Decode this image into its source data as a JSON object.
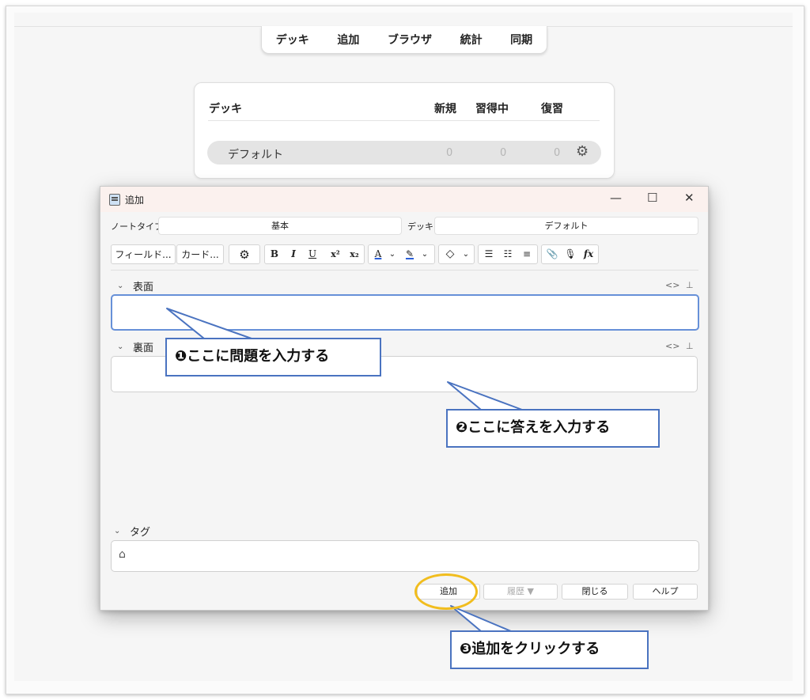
{
  "topnav": [
    "デッキ",
    "追加",
    "ブラウザ",
    "統計",
    "同期"
  ],
  "decklist": {
    "header": {
      "deck": "デッキ",
      "new": "新規",
      "learning": "習得中",
      "review": "復習"
    },
    "rows": [
      {
        "name": "デフォルト",
        "new": "0",
        "learning": "0",
        "review": "0"
      }
    ],
    "gear_icon": "gear-icon"
  },
  "window": {
    "title": "追加",
    "controls": {
      "minimize": "—",
      "maximize": "☐",
      "close": "✕"
    },
    "notetype_label": "ノートタイプ",
    "notetype_value": "基本",
    "deck_label": "デッキ",
    "deck_value": "デフォルト",
    "toolbar": {
      "fields_button": "フィールド...",
      "cards_button": "カード...",
      "gear": "⚙",
      "bold": "B",
      "italic": "I",
      "underline": "U",
      "sup": "x²",
      "sub": "x₂",
      "text_color": "A",
      "highlight": "✎",
      "dropdown": "⌄",
      "eraser": "◇",
      "ul": "☰",
      "ol": "☷",
      "align": "≡",
      "attach": "📎",
      "mic": "🎙",
      "fx": "fx"
    },
    "fields": [
      {
        "label": "表面",
        "value": ""
      },
      {
        "label": "裏面",
        "value": ""
      }
    ],
    "field_icons": {
      "html": "<>",
      "pin": "⊥"
    },
    "tags_label": "タグ",
    "tag_icon": "tag-icon",
    "buttons": {
      "add": "追加",
      "history": "履歴 ▼",
      "close": "閉じる",
      "help": "ヘルプ"
    }
  },
  "callouts": [
    "❶ここに問題を入力する",
    "❷ここに答えを入力する",
    "❸追加をクリックする"
  ],
  "colors": {
    "callout_border": "#4a73c0",
    "ring": "#f1bd1e",
    "focus": "#6690d8"
  }
}
